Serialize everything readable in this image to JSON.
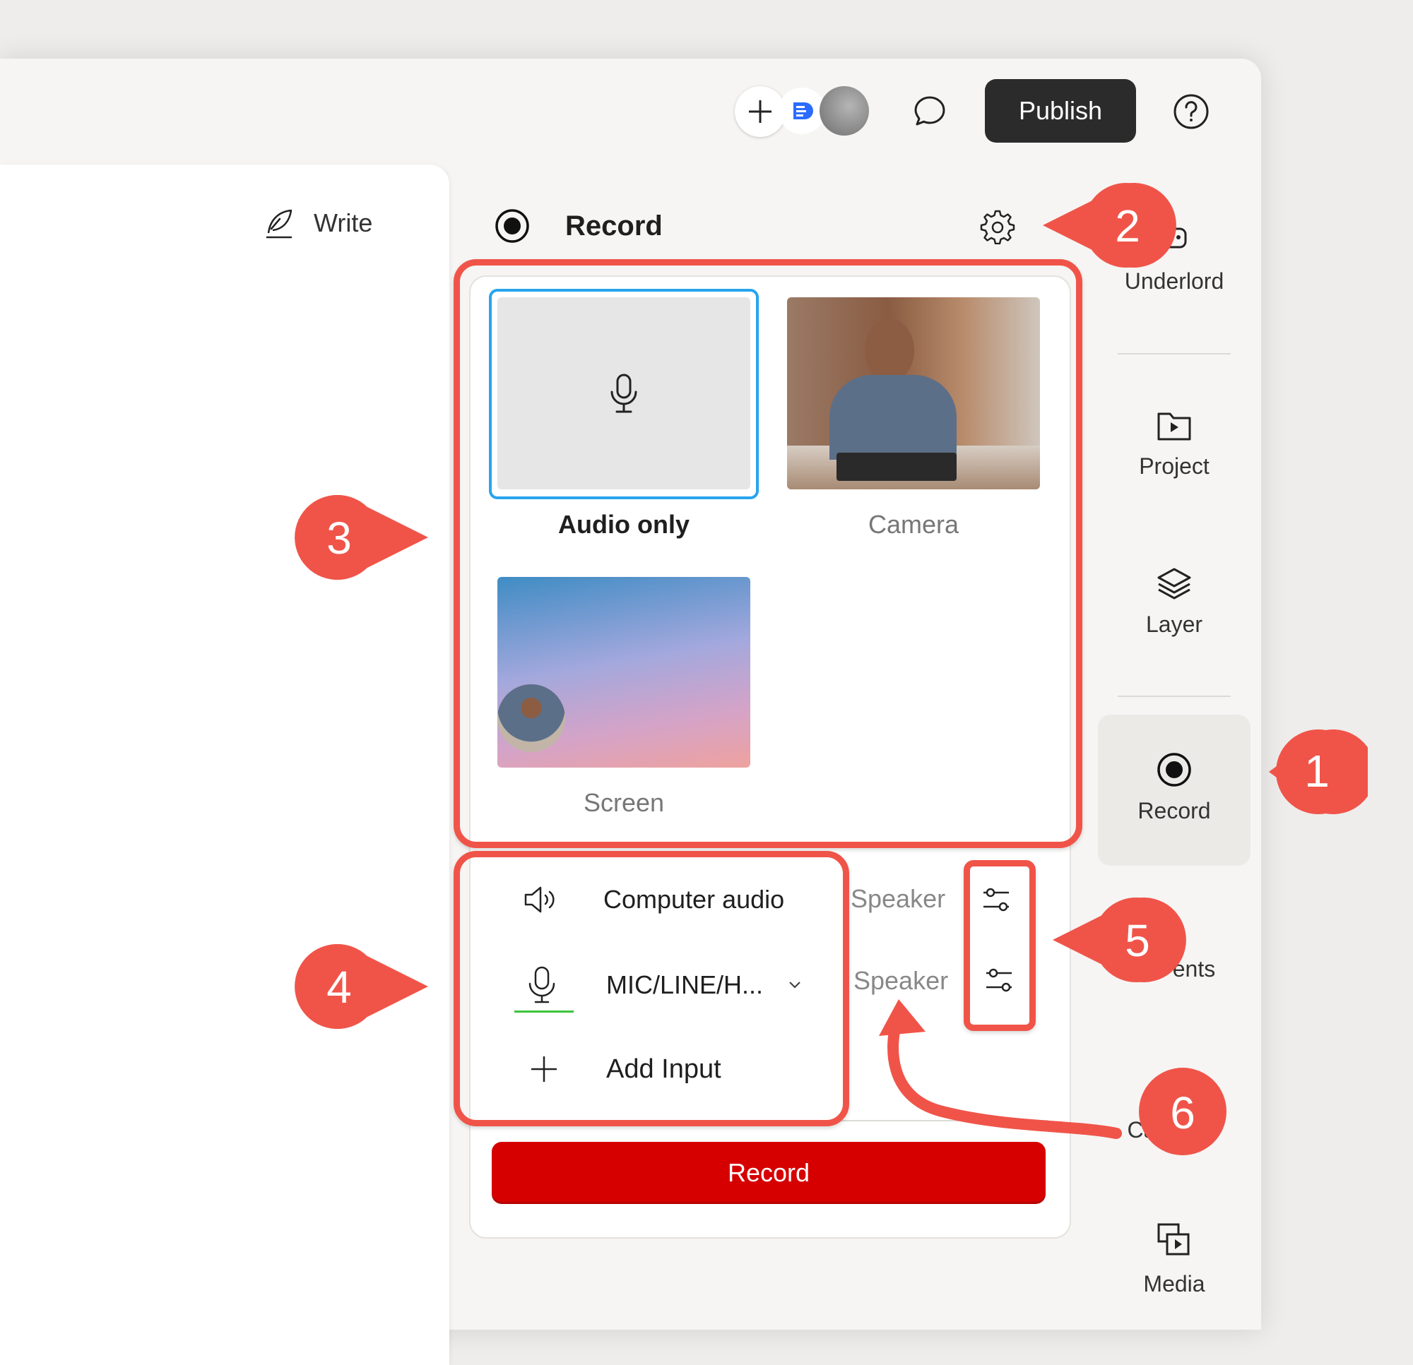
{
  "topbar": {
    "publish_label": "Publish"
  },
  "editor": {
    "write_label": "Write"
  },
  "record_panel": {
    "title": "Record",
    "modes": [
      {
        "label": "Audio only",
        "selected": true
      },
      {
        "label": "Camera",
        "selected": false
      },
      {
        "label": "Screen",
        "selected": false
      }
    ],
    "inputs": {
      "computer_audio": "Computer audio",
      "mic": "MIC/LINE/H...",
      "add_input": "Add Input",
      "speaker_1": "Speaker",
      "speaker_2": "Speaker"
    },
    "record_button": "Record"
  },
  "sidebar": {
    "items": [
      {
        "label": "Underlord",
        "icon": "underlord-icon"
      },
      {
        "label": "Project",
        "icon": "project-folder-icon"
      },
      {
        "label": "Layer",
        "icon": "layers-icon"
      },
      {
        "label": "Record",
        "icon": "record-icon",
        "active": true
      },
      {
        "label": "ents",
        "icon": "elements-icon"
      },
      {
        "label": "Ca",
        "icon": "captions-icon"
      },
      {
        "label": "Media",
        "icon": "media-icon"
      }
    ]
  },
  "callouts": [
    "1",
    "2",
    "3",
    "4",
    "5",
    "6"
  ],
  "colors": {
    "accent_red": "#d60000",
    "callout_red": "#f05449",
    "selection_blue": "#28a5ee",
    "mic_level_green": "#3bc43b"
  }
}
